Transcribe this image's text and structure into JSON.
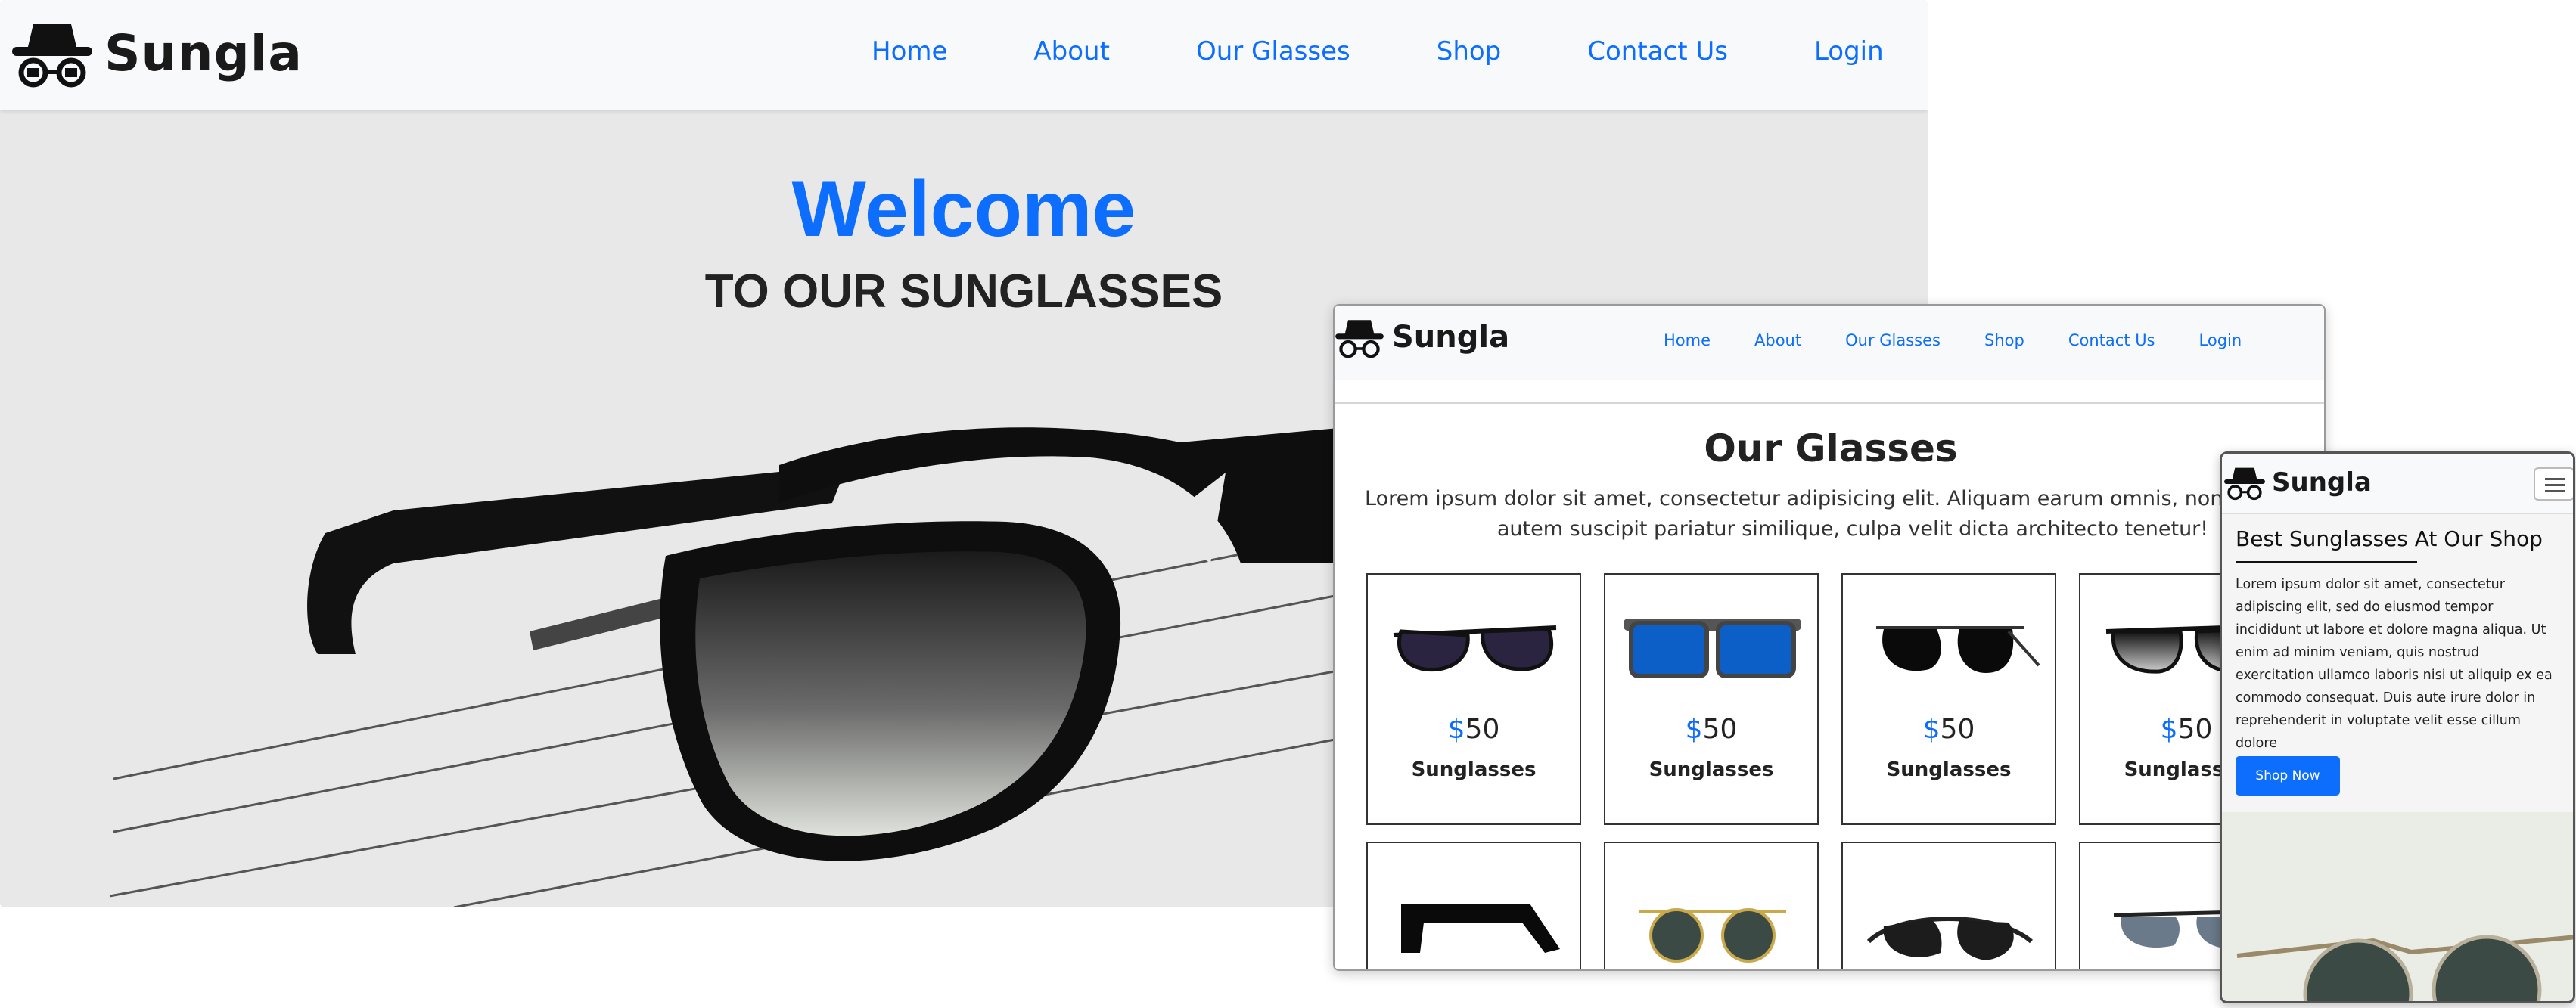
{
  "brand": {
    "name": "Sungla",
    "logo_icon": "spy-hat-glasses-icon"
  },
  "nav": {
    "items": [
      "Home",
      "About",
      "Our Glasses",
      "Shop",
      "Contact Us",
      "Login"
    ]
  },
  "colors": {
    "accent": "#0d6efd",
    "nav_bg": "#f8f9fa",
    "hero_bg": "#e8e8e8",
    "text_dark": "#222222"
  },
  "desktop": {
    "hero_title": "Welcome",
    "hero_subtitle": "TO OUR SUNGLASSES"
  },
  "glasses_section": {
    "title": "Our Glasses",
    "description_line1": "Lorem ipsum dolor sit amet, consectetur adipisicing elit. Aliquam earum omnis, non illum accusantium",
    "description_line2": "autem suscipit pariatur similique, culpa velit dicta architecto tenetur!",
    "products": [
      {
        "currency": "$",
        "price": "50",
        "name": "Sunglasses",
        "image": "cat-eye-sunglasses-icon"
      },
      {
        "currency": "$",
        "price": "50",
        "name": "Sunglasses",
        "image": "blue-mirror-sunglasses-icon"
      },
      {
        "currency": "$",
        "price": "50",
        "name": "Sunglasses",
        "image": "aviator-sunglasses-icon"
      },
      {
        "currency": "$",
        "price": "50",
        "name": "Sunglasses",
        "image": "gradient-sunglasses-icon"
      }
    ],
    "products_row2": [
      {
        "image": "side-view-sunglasses-icon"
      },
      {
        "image": "round-gold-sunglasses-icon"
      },
      {
        "image": "black-wrap-sunglasses-icon"
      },
      {
        "image": "sport-rimless-sunglasses-icon"
      }
    ]
  },
  "mobile": {
    "headline": "Best Sunglasses At Our Shop",
    "body": "Lorem ipsum dolor sit amet, consectetur adipiscing elit, sed do eiusmod tempor incididunt ut labore et dolore magna aliqua. Ut enim ad minim veniam, quis nostrud exercitation ullamco laboris nisi ut aliquip ex ea commodo consequat. Duis aute irure dolor in reprehenderit in voluptate velit esse cillum dolore",
    "cta_label": "Shop Now",
    "menu_icon": "hamburger-menu-icon"
  }
}
